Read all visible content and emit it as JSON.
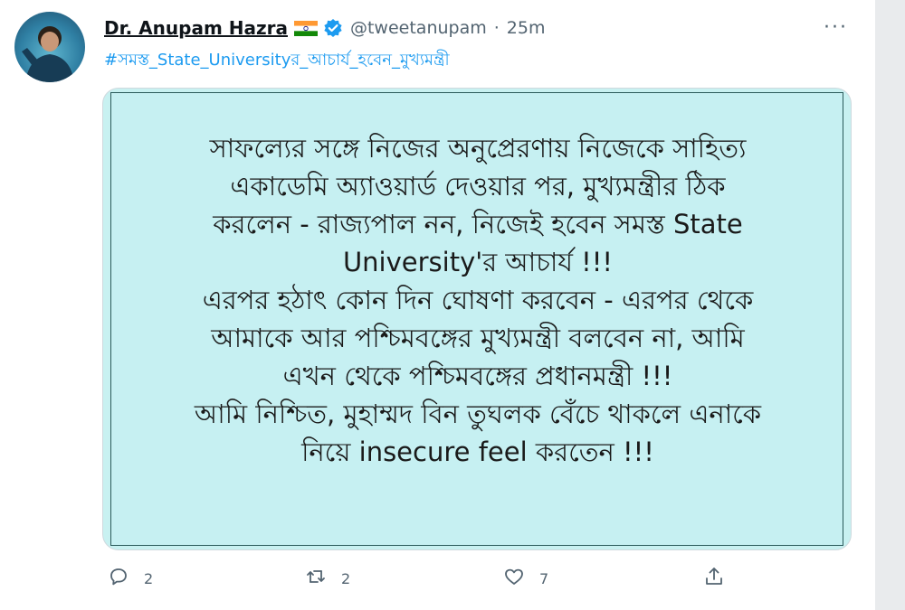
{
  "author": {
    "name": "Dr. Anupam Hazra",
    "handle": "@tweetanupam",
    "time": "25m",
    "flag_icon": "india-flag-icon",
    "verified_icon": "verified-badge-icon"
  },
  "header": {
    "separator": "·",
    "more_label": "···"
  },
  "hashtag": "#সমস্ত_State_Universityর_আচার্য_হবেন_মুখ্যমন্ত্রী",
  "post_text": "সাফল্যের সঙ্গে নিজের অনুপ্রেরণায় নিজেকে সাহিত্য\nএকাডেমি অ্যাওয়ার্ড দেওয়ার পর, মুখ্যমন্ত্রীর ঠিক\nকরলেন - রাজ্যপাল নন, নিজেই হবেন সমস্ত State\nUniversity'র আচার্য !!!\nএরপর হঠাৎ কোন দিন ঘোষণা করবেন - এরপর থেকে\nআমাকে আর পশ্চিমবঙ্গের মুখ্যমন্ত্রী বলবেন না, আমি\nএখন থেকে পশ্চিমবঙ্গের প্রধানমন্ত্রী !!!\nআমি নিশ্চিত, মুহাম্মদ বিন তুঘলক বেঁচে থাকলে এনাকে\nনিয়ে insecure feel করতেন !!!",
  "actions": {
    "replies": "2",
    "retweets": "2",
    "likes": "7"
  },
  "colors": {
    "accent": "#1d9bf0",
    "card_bg": "#c6f0f2",
    "muted": "#536471"
  }
}
